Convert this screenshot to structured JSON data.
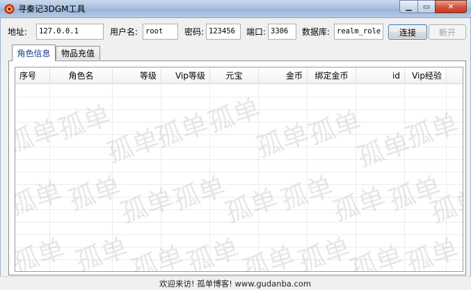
{
  "window": {
    "title": "寻秦记3DGM工具",
    "minimize_glyph": "▁",
    "maximize_glyph": "▭",
    "close_glyph": "✕"
  },
  "connection": {
    "host_label": "地址:",
    "host_value": "127.0.0.1",
    "user_label": "用户名:",
    "user_value": "root",
    "password_label": "密码:",
    "password_value": "123456",
    "port_label": "端口:",
    "port_value": "3306",
    "database_label": "数据库:",
    "database_value": "realm_role",
    "connect_label": "连接",
    "disconnect_label": "断开"
  },
  "tabs": [
    {
      "label": "角色信息",
      "active": true
    },
    {
      "label": "物品充值",
      "active": false
    }
  ],
  "grid": {
    "columns": [
      "序号",
      "角色名",
      "等级",
      "Vip等级",
      "元宝",
      "金币",
      "绑定金币",
      "id",
      "Vip经验"
    ],
    "rows": [],
    "watermark": "孤单"
  },
  "status_bar": {
    "text": "欢迎来访! 孤单博客! www.gudanba.com"
  },
  "colors": {
    "accent": "#3c7fb1",
    "active_tab_text": "#1a3d8f",
    "close_button": "#c83b20"
  }
}
